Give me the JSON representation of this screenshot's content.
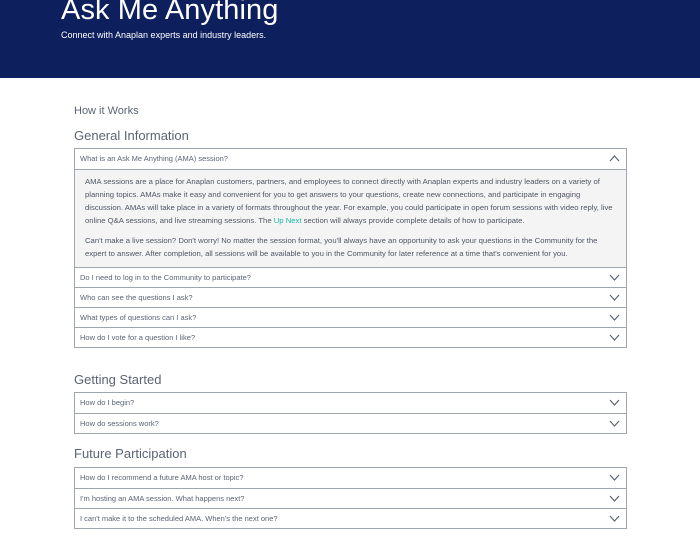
{
  "hero": {
    "title": "Ask Me Anything",
    "subtitle": "Connect with Anaplan experts and industry leaders."
  },
  "how_it_works": "How it Works",
  "sections": [
    {
      "title": "General Information",
      "items": [
        {
          "question": "What is an Ask Me Anything (AMA) session?",
          "expanded": true,
          "answer": {
            "p1_before_link": "AMA sessions are a place for Anaplan customers, partners, and employees to connect directly with Anaplan experts and industry leaders on a variety of planning topics. AMAs make it easy and convenient for you to get answers to your questions, create new connections, and participate in engaging discussion. AMAs will take place in a variety of formats throughout the year. For example, you could participate in open forum sessions with video reply, live online Q&A sessions, and live streaming sessions. The ",
            "p1_link": "Up Next",
            "p1_after_link": " section will always provide complete details of how to participate.",
            "p2": "Can't make a live session? Don't worry! No matter the session format, you'll always have an opportunity to ask your questions in the Community for the expert to answer. After completion, all sessions will be available to you in the Community for later reference at a time that's convenient for you."
          }
        },
        {
          "question": "Do I need to log in to the Community to participate?",
          "expanded": false
        },
        {
          "question": "Who can see the questions I ask?",
          "expanded": false
        },
        {
          "question": "What types of questions can I ask?",
          "expanded": false
        },
        {
          "question": "How do I vote for a question I like?",
          "expanded": false
        }
      ]
    },
    {
      "title": "Getting Started",
      "items": [
        {
          "question": "How do I begin?",
          "expanded": false
        },
        {
          "question": "How do sessions work?",
          "expanded": false
        }
      ]
    },
    {
      "title": "Future Participation",
      "items": [
        {
          "question": "How do I recommend a future AMA host or topic?",
          "expanded": false
        },
        {
          "question": "I'm hosting an AMA session. What happens next?",
          "expanded": false
        },
        {
          "question": "I can't make it to the scheduled AMA. When's the next one?",
          "expanded": false
        }
      ]
    }
  ],
  "icons": {
    "collapse": "chevron-up-icon",
    "expand": "chevron-down-icon"
  },
  "colors": {
    "hero_bg": "#0d1f5c",
    "link": "#1db5a8",
    "border": "#a0a6b0",
    "panel_bg": "#f4f4f4"
  }
}
